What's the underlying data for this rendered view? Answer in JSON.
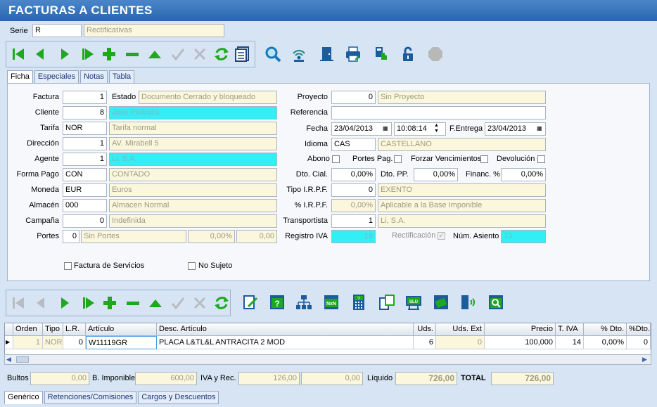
{
  "window": {
    "title": "FACTURAS A CLIENTES"
  },
  "serie": {
    "label": "Serie",
    "value": "R",
    "description": "Rectificativas"
  },
  "tabs": [
    {
      "label": "Ficha",
      "key": "F"
    },
    {
      "label": "Especiales",
      "key": "E"
    },
    {
      "label": "Notas",
      "key": "N"
    },
    {
      "label": "Tabla",
      "key": "T"
    }
  ],
  "form": {
    "factura": {
      "label": "Factura",
      "value": "1"
    },
    "estado": {
      "label": "Estado",
      "value": "Documento Cerrado y bloqueado"
    },
    "cliente": {
      "label": "Cliente",
      "value": "8",
      "name": "Jose Pedraza"
    },
    "tarifa": {
      "label": "Tarifa",
      "value": "NOR",
      "name": "Tarifa normal"
    },
    "direccion": {
      "label": "Dirección",
      "value": "1",
      "name": "AV. Mirabell 5"
    },
    "agente": {
      "label": "Agente",
      "value": "1",
      "name": "Li, S.A."
    },
    "forma_pago": {
      "label": "Forma Pago",
      "value": "CON",
      "name": "CONTADO"
    },
    "moneda": {
      "label": "Moneda",
      "value": "EUR",
      "name": "Euros"
    },
    "almacen": {
      "label": "Almacén",
      "value": "000",
      "name": "Almacen Normal"
    },
    "campana": {
      "label": "Campaña",
      "value": "0",
      "name": "Indefinida"
    },
    "portes": {
      "label": "Portes",
      "value": "0",
      "name": "Sin Portes",
      "pct": "0,00%",
      "amount": "0,00"
    },
    "proyecto": {
      "label": "Proyecto",
      "value": "0",
      "name": "Sin Proyecto"
    },
    "referencia": {
      "label": "Referencia",
      "value": ""
    },
    "fecha": {
      "label": "Fecha",
      "value": "23/04/2013",
      "time": "10:08:14"
    },
    "fentrega": {
      "label": "F.Entrega",
      "value": "23/04/2013"
    },
    "idioma": {
      "label": "Idioma",
      "value": "CAS",
      "name": "CASTELLANO"
    },
    "abono": {
      "label": "Abono"
    },
    "portes_pag": {
      "label": "Portes Pag."
    },
    "forzar": {
      "label": "Forzar Vencimientos"
    },
    "devolucion": {
      "label": "Devolución"
    },
    "dto_cial": {
      "label": "Dto. Cial.",
      "value": "0,00%"
    },
    "dto_pp": {
      "label": "Dto. PP.",
      "value": "0,00%"
    },
    "financ": {
      "label": "Financ. %",
      "value": "0,00%"
    },
    "tipo_irpf": {
      "label": "Tipo I.R.P.F.",
      "value": "0",
      "name": "EXENTO"
    },
    "pct_irpf": {
      "label": "% I.R.P.F.",
      "value": "0,00%",
      "name": "Aplicable a la Base Imponible"
    },
    "transportista": {
      "label": "Transportista",
      "value": "1",
      "name": "Li, S.A."
    },
    "registro_iva": {
      "label": "Registro IVA",
      "value": "18"
    },
    "rectificacion": {
      "label": "Rectificación"
    },
    "num_asiento": {
      "label": "Núm. Asiento",
      "value": "73"
    },
    "factura_servicios": {
      "label": "Factura de Servicios"
    },
    "no_sujeto": {
      "label": "No Sujeto"
    }
  },
  "grid": {
    "columns": [
      "Orden",
      "Tipo",
      "L.R.",
      "Artículo",
      "Desc. Artículo",
      "Uds.",
      "Uds. Ext",
      "Precio",
      "T. IVA",
      "% Dto.",
      "%Dto.2"
    ],
    "rows": [
      {
        "orden": "1",
        "tipo": "NOR",
        "lr": "0",
        "articulo": "W11119GR",
        "desc": "PLACA L&TL&L ANTRACITA 2 MOD",
        "uds": "6",
        "uds_ext": "0",
        "precio": "100,000",
        "tiva": "14",
        "dto": "0,00%",
        "dto2": "0"
      }
    ]
  },
  "totals": {
    "bultos_label": "Bultos",
    "bultos": "0,00",
    "base_label": "B. Imponible",
    "base": "600,00",
    "iva_label": "IVA y Rec.",
    "iva": "126,00",
    "rec": "0,00",
    "liquido_label": "Líquido",
    "liquido": "726,00",
    "total_label": "TOTAL",
    "total": "726,00"
  },
  "bottom_tabs": [
    {
      "label": "Genérico",
      "key": "G"
    },
    {
      "label": "Retenciones/Comisiones",
      "key": "R"
    },
    {
      "label": "Cargos y Descuentos",
      "key": "C"
    }
  ],
  "colors": {
    "accent": "#2a66ac",
    "readonly": "#fbf7dc",
    "highlight": "#33eef5"
  }
}
